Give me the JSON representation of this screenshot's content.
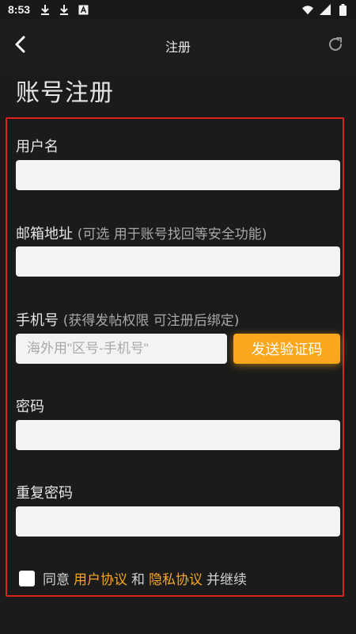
{
  "status_bar": {
    "time": "8:53"
  },
  "toolbar": {
    "title": "注册"
  },
  "page": {
    "title": "账号注册"
  },
  "form": {
    "username": {
      "label": "用户名",
      "value": "",
      "placeholder": ""
    },
    "email": {
      "label": "邮箱地址",
      "hint": "(可选 用于账号找回等安全功能)",
      "value": "",
      "placeholder": ""
    },
    "phone": {
      "label": "手机号",
      "hint": "(获得发帖权限 可注册后绑定)",
      "value": "",
      "placeholder": "海外用\"区号-手机号\""
    },
    "send_code_label": "发送验证码",
    "password": {
      "label": "密码",
      "value": "",
      "placeholder": ""
    },
    "confirm_password": {
      "label": "重复密码",
      "value": "",
      "placeholder": ""
    }
  },
  "agreement": {
    "checked": false,
    "prefix": "同意",
    "user_agreement": "用户协议",
    "and": "和",
    "privacy_policy": "隐私协议",
    "suffix": "并继续"
  },
  "colors": {
    "accent": "#fba71e",
    "link": "#f5a623",
    "highlight_border": "#e0221f",
    "background": "#1b1b1b"
  },
  "icons": [
    "download-icon",
    "download-icon",
    "a-box-icon",
    "wifi-icon",
    "signal-icon",
    "battery-icon",
    "back-arrow-icon",
    "refresh-icon"
  ]
}
